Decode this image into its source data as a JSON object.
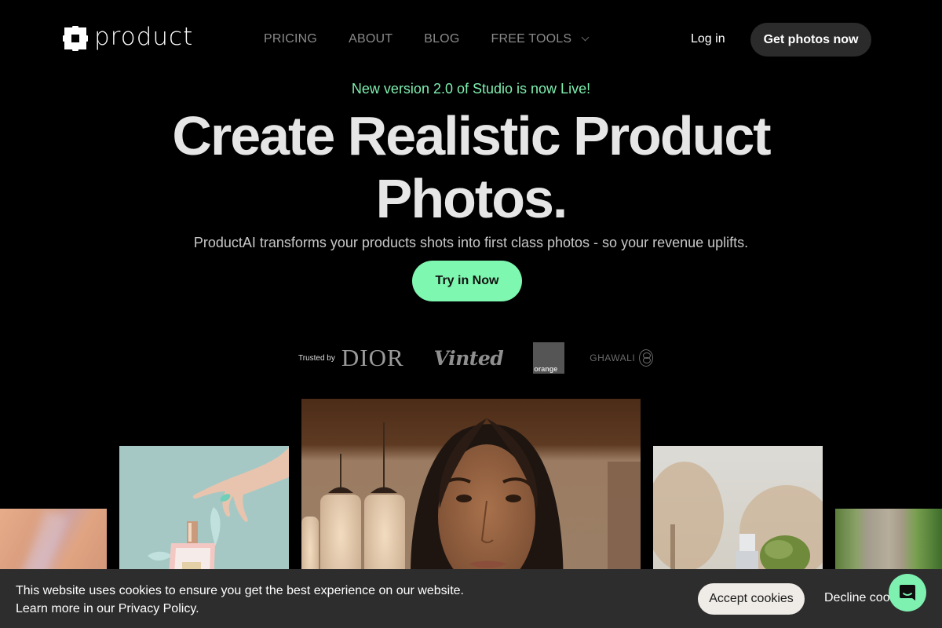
{
  "brand": {
    "name": "product",
    "accent_color": "#7ef7b0"
  },
  "nav": {
    "links": [
      {
        "label": "PRICING"
      },
      {
        "label": "ABOUT"
      },
      {
        "label": "BLOG"
      },
      {
        "label": "FREE TOOLS",
        "has_dropdown": true
      }
    ],
    "login_label": "Log in",
    "cta_label": "Get photos now"
  },
  "hero": {
    "announcement": "New version 2.0 of Studio is now Live!",
    "headline_line1": "Create Realistic Product",
    "headline_line2": "Photos.",
    "subheadline": "ProductAI transforms your products shots into first class photos - so your revenue uplifts.",
    "cta_label": "Try in Now"
  },
  "trusted": {
    "label": "Trusted by",
    "logos": [
      "DIOR",
      "Vinted",
      "orange",
      "GHAWALI"
    ]
  },
  "gallery": {
    "images": [
      {
        "subject": "close-up skin texture"
      },
      {
        "subject": "hand reaching perfume bottle on teal background"
      },
      {
        "subject": "woman portrait with pendant lights"
      },
      {
        "subject": "spray bottle with bonsai in autumn park"
      },
      {
        "subject": "stone pillar with green foliage"
      }
    ]
  },
  "cookie_banner": {
    "line1": "This website uses cookies to ensure you get the best experience on our website.",
    "line2": "Learn more in our Privacy Policy.",
    "accept_label": "Accept cookies",
    "decline_label": "Decline cookies"
  }
}
